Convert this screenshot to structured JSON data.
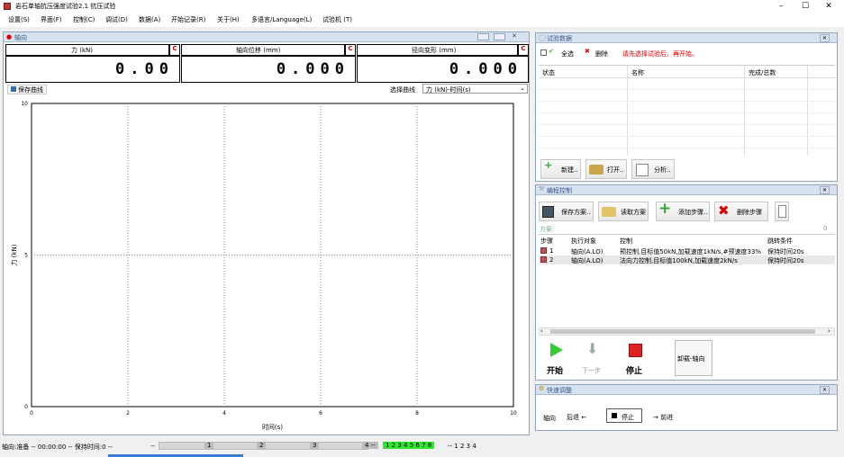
{
  "app": {
    "title": "岩石单轴抗压强度试验2.1  抗压试验"
  },
  "menu": [
    "设置(S)",
    "界面(F)",
    "控制(C)",
    "调试(D)",
    "数据(A)",
    "开始记录(R)",
    "关于(H)",
    "多语言/Language(L)",
    "试验机 (T)"
  ],
  "axis_panel": {
    "title": "轴向",
    "c": "C",
    "channels": [
      {
        "label": "力  (kN)",
        "value": "0.00"
      },
      {
        "label": "轴向位移  (mm)",
        "value": "0.000"
      },
      {
        "label": "径向变形  (mm)",
        "value": "0.000"
      }
    ],
    "save_curve": "保存曲线",
    "select_curve_label": "选择曲线",
    "select_curve_value": "力  (kN)-时间(s)"
  },
  "chart_data": {
    "type": "line",
    "xlabel": "时间(s)",
    "ylabel": "力  (kN)",
    "xlim": [
      0,
      10
    ],
    "ylim": [
      0,
      10
    ],
    "x_ticks": [
      "0",
      "2",
      "4",
      "6",
      "8",
      "10"
    ],
    "y_ticks": [
      "0",
      "5",
      "10"
    ],
    "series": [],
    "grid": true
  },
  "test_data": {
    "title": "试验数据",
    "select_all": "全选",
    "delete": "删除",
    "hint": "请先选择试验后，再开始。",
    "columns": [
      "状态",
      "名称",
      "完成/总数"
    ],
    "new": "新建..",
    "open": "打开..",
    "analyze": "分析.."
  },
  "program": {
    "title": "编程控制",
    "save": "保存方案..",
    "read": "读取方案",
    "add": "添加步骤..",
    "del": "删除步骤",
    "scheme": "方案:",
    "scheme_right": "0",
    "columns": [
      "步骤",
      "执行对象",
      "控制",
      "跳转条件"
    ],
    "rows": [
      {
        "step": "1",
        "obj": "轴向(A.LO)",
        "ctrl": "预控制,目标值50kN,加载速度1kN/s,#预速度33%",
        "jump": "保持时间20s"
      },
      {
        "step": "2",
        "obj": "轴向(A.LO)",
        "ctrl": "法向力控制,目标值100kN,加载速度2kN/s",
        "jump": "保持时间20s"
      }
    ],
    "start": "开始",
    "next": "下一步",
    "stop": "停止",
    "unload": "卸载-轴向"
  },
  "quick": {
    "title": "快速调整",
    "axis": "轴向",
    "back": "后退 ←",
    "stop": "停止",
    "fwd": "→ 前进"
  },
  "status": {
    "text": "轴向:准备  --  00:00:00  --  保持时间:0  --",
    "sep": "--",
    "b1": "1",
    "b2": "2",
    "b3": "3",
    "b4": "4 --",
    "green": "1 2 3 4 5 6 7 8",
    "tail": "-- 1 2 3 4"
  }
}
